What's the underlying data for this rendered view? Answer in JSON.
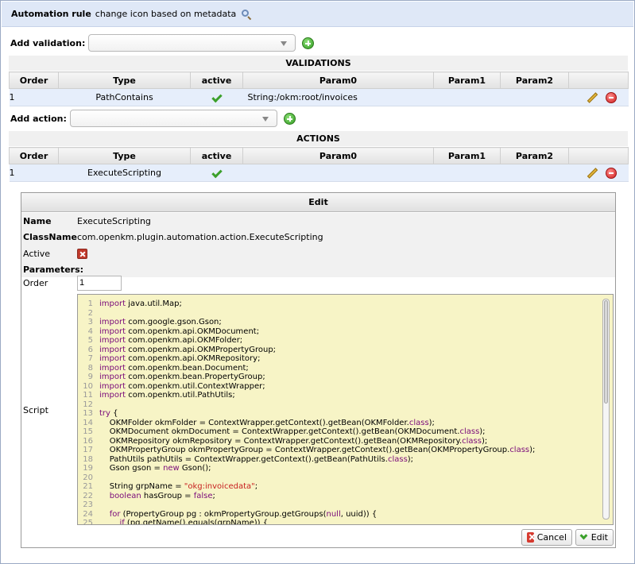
{
  "title": {
    "prefix": "Automation rule",
    "name": "change icon based on metadata"
  },
  "validations": {
    "add_label": "Add validation:",
    "section": "VALIDATIONS",
    "headers": [
      "Order",
      "Type",
      "active",
      "Param0",
      "Param1",
      "Param2"
    ],
    "rows": [
      {
        "order": "1",
        "type": "PathContains",
        "param0": "String:/okm:root/invoices",
        "param1": "",
        "param2": ""
      }
    ]
  },
  "actions": {
    "add_label": "Add action:",
    "section": "ACTIONS",
    "headers": [
      "Order",
      "Type",
      "active",
      "Param0",
      "Param1",
      "Param2"
    ],
    "rows": [
      {
        "order": "1",
        "type": "ExecuteScripting",
        "param0": "",
        "param1": "",
        "param2": ""
      }
    ]
  },
  "edit": {
    "header": "Edit",
    "name_label": "Name",
    "name_value": "ExecuteScripting",
    "class_label": "ClassName",
    "class_value": "com.openkm.plugin.automation.action.ExecuteScripting",
    "active_label": "Active",
    "parameters_label": "Parameters:",
    "order_label": "Order",
    "order_value": "1",
    "script_label": "Script",
    "code": [
      "import java.util.Map;",
      "",
      "import com.google.gson.Gson;",
      "import com.openkm.api.OKMDocument;",
      "import com.openkm.api.OKMFolder;",
      "import com.openkm.api.OKMPropertyGroup;",
      "import com.openkm.api.OKMRepository;",
      "import com.openkm.bean.Document;",
      "import com.openkm.bean.PropertyGroup;",
      "import com.openkm.util.ContextWrapper;",
      "import com.openkm.util.PathUtils;",
      "",
      "try {",
      "    OKMFolder okmFolder = ContextWrapper.getContext().getBean(OKMFolder.class);",
      "    OKMDocument okmDocument = ContextWrapper.getContext().getBean(OKMDocument.class);",
      "    OKMRepository okmRepository = ContextWrapper.getContext().getBean(OKMRepository.class);",
      "    OKMPropertyGroup okmPropertyGroup = ContextWrapper.getContext().getBean(OKMPropertyGroup.class);",
      "    PathUtils pathUtils = ContextWrapper.getContext().getBean(PathUtils.class);",
      "    Gson gson = new Gson();",
      "",
      "    String grpName = \"okg:invoicedata\";",
      "    boolean hasGroup = false;",
      "",
      "    for (PropertyGroup pg : okmPropertyGroup.getGroups(null, uuid)) {",
      "        if (pg.getName().equals(grpName)) {"
    ],
    "cancel_label": "Cancel",
    "edit_label": "Edit"
  }
}
